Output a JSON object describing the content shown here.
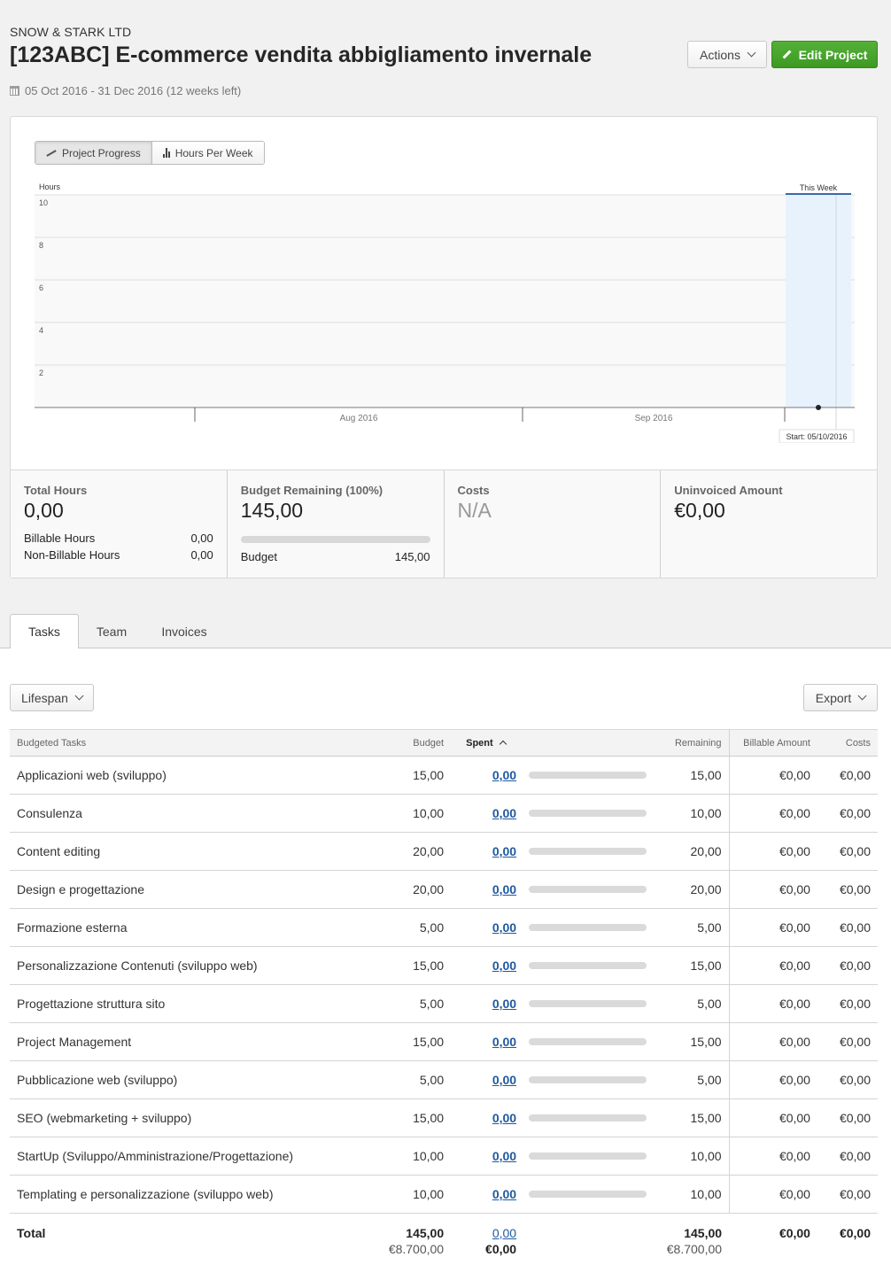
{
  "header": {
    "client": "SNOW & STARK LTD",
    "title": "[123ABC] E-commerce vendita abbigliamento invernale",
    "dates": "05 Oct 2016 - 31 Dec 2016 (12 weeks left)",
    "actions_label": "Actions",
    "edit_label": "Edit Project"
  },
  "chart_toggle": {
    "progress_label": "Project Progress",
    "hours_label": "Hours Per Week"
  },
  "chart_data": {
    "type": "line",
    "title": "",
    "ylabel": "Hours",
    "xlabel": "",
    "ylim": [
      0,
      10
    ],
    "yticks": [
      2,
      4,
      6,
      8,
      10
    ],
    "x_tick_labels": [
      "Aug 2016",
      "Sep 2016"
    ],
    "highlight_label": "This Week",
    "start_annotation": "Start: 05/10/2016",
    "series": [
      {
        "name": "Hours",
        "points": [
          {
            "x": "05/10/2016",
            "y": 0
          }
        ]
      }
    ],
    "grid": true
  },
  "stats": {
    "total_hours": {
      "label": "Total Hours",
      "value": "0,00",
      "billable_label": "Billable Hours",
      "billable_value": "0,00",
      "nonbillable_label": "Non-Billable Hours",
      "nonbillable_value": "0,00"
    },
    "budget": {
      "label": "Budget Remaining (100%)",
      "value": "145,00",
      "spent_fraction": 0,
      "budget_label": "Budget",
      "budget_value": "145,00"
    },
    "costs": {
      "label": "Costs",
      "value": "N/A"
    },
    "uninvoiced": {
      "label": "Uninvoiced Amount",
      "value": "€0,00"
    }
  },
  "tabs": [
    {
      "label": "Tasks",
      "active": true
    },
    {
      "label": "Team",
      "active": false
    },
    {
      "label": "Invoices",
      "active": false
    }
  ],
  "toolbar": {
    "lifespan_label": "Lifespan",
    "export_label": "Export"
  },
  "table": {
    "headers": {
      "task": "Budgeted Tasks",
      "budget": "Budget",
      "spent": "Spent",
      "remaining": "Remaining",
      "billable": "Billable Amount",
      "costs": "Costs"
    },
    "rows": [
      {
        "name": "Applicazioni web (sviluppo)",
        "budget": "15,00",
        "spent": "0,00",
        "progress": 0,
        "remaining": "15,00",
        "billable": "€0,00",
        "costs": "€0,00"
      },
      {
        "name": "Consulenza",
        "budget": "10,00",
        "spent": "0,00",
        "progress": 0,
        "remaining": "10,00",
        "billable": "€0,00",
        "costs": "€0,00"
      },
      {
        "name": "Content editing",
        "budget": "20,00",
        "spent": "0,00",
        "progress": 0,
        "remaining": "20,00",
        "billable": "€0,00",
        "costs": "€0,00"
      },
      {
        "name": "Design e progettazione",
        "budget": "20,00",
        "spent": "0,00",
        "progress": 0,
        "remaining": "20,00",
        "billable": "€0,00",
        "costs": "€0,00"
      },
      {
        "name": "Formazione esterna",
        "budget": "5,00",
        "spent": "0,00",
        "progress": 0,
        "remaining": "5,00",
        "billable": "€0,00",
        "costs": "€0,00"
      },
      {
        "name": "Personalizzazione Contenuti (sviluppo web)",
        "budget": "15,00",
        "spent": "0,00",
        "progress": 0,
        "remaining": "15,00",
        "billable": "€0,00",
        "costs": "€0,00"
      },
      {
        "name": "Progettazione struttura sito",
        "budget": "5,00",
        "spent": "0,00",
        "progress": 0,
        "remaining": "5,00",
        "billable": "€0,00",
        "costs": "€0,00"
      },
      {
        "name": "Project Management",
        "budget": "15,00",
        "spent": "0,00",
        "progress": 0,
        "remaining": "15,00",
        "billable": "€0,00",
        "costs": "€0,00"
      },
      {
        "name": "Pubblicazione web (sviluppo)",
        "budget": "5,00",
        "spent": "0,00",
        "progress": 0,
        "remaining": "5,00",
        "billable": "€0,00",
        "costs": "€0,00"
      },
      {
        "name": "SEO (webmarketing + sviluppo)",
        "budget": "15,00",
        "spent": "0,00",
        "progress": 0,
        "remaining": "15,00",
        "billable": "€0,00",
        "costs": "€0,00"
      },
      {
        "name": "StartUp (Sviluppo/Amministrazione/Progettazione)",
        "budget": "10,00",
        "spent": "0,00",
        "progress": 0,
        "remaining": "10,00",
        "billable": "€0,00",
        "costs": "€0,00"
      },
      {
        "name": "Templating e personalizzazione (sviluppo web)",
        "budget": "10,00",
        "spent": "0,00",
        "progress": 0,
        "remaining": "10,00",
        "billable": "€0,00",
        "costs": "€0,00"
      }
    ],
    "total": {
      "label": "Total",
      "budget": "145,00",
      "budget_amount": "€8.700,00",
      "spent": "0,00",
      "spent_amount": "€0,00",
      "remaining": "145,00",
      "remaining_amount": "€8.700,00",
      "billable": "€0,00",
      "costs": "€0,00"
    }
  }
}
